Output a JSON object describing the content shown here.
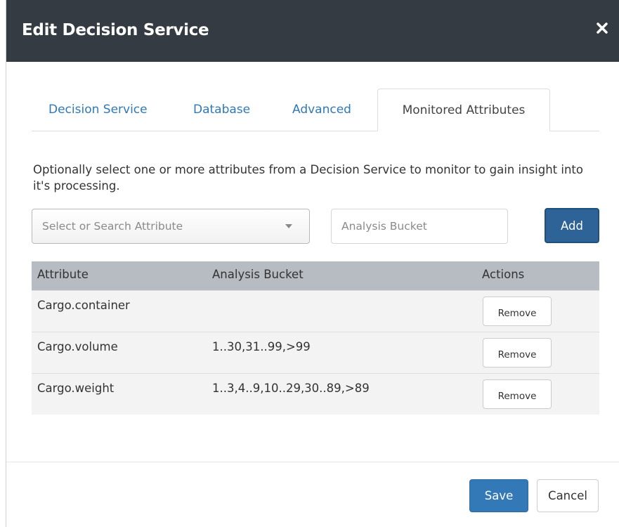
{
  "dialog": {
    "title": "Edit Decision Service",
    "close_icon": "close-icon"
  },
  "tabs": [
    {
      "label": "Decision Service",
      "active": false
    },
    {
      "label": "Database",
      "active": false
    },
    {
      "label": "Advanced",
      "active": false
    },
    {
      "label": "Monitored Attributes",
      "active": true
    }
  ],
  "help_text": "Optionally select one or more attributes from a Decision Service to monitor to gain insight into it's processing.",
  "attribute_select": {
    "placeholder": "Select or Search Attribute"
  },
  "bucket_input": {
    "placeholder": "Analysis Bucket",
    "value": ""
  },
  "add_label": "Add",
  "table": {
    "headers": [
      "Attribute",
      "Analysis Bucket",
      "Actions"
    ],
    "rows": [
      {
        "attribute": "Cargo.container",
        "bucket": "",
        "action": "Remove"
      },
      {
        "attribute": "Cargo.volume",
        "bucket": "1..30,31..99,>99",
        "action": "Remove"
      },
      {
        "attribute": "Cargo.weight",
        "bucket": "1..3,4..9,10..29,30..89,>89",
        "action": "Remove"
      }
    ]
  },
  "footer": {
    "save_label": "Save",
    "cancel_label": "Cancel"
  },
  "colors": {
    "header_bg": "#343b42",
    "link_blue": "#2f79b8",
    "primary_button": "#3479b7",
    "add_button": "#2e6397",
    "table_header_bg": "#b6bcc2",
    "row_bg": "#f3f3f3"
  }
}
